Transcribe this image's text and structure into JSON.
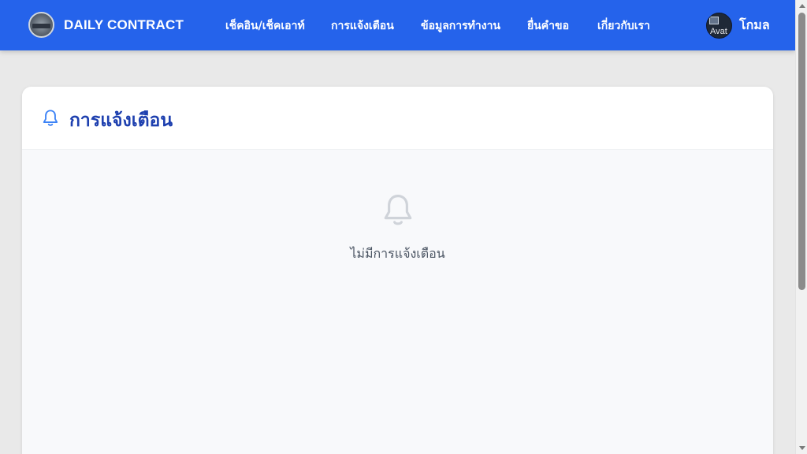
{
  "brand": {
    "name": "DAILY CONTRACT",
    "logo_icon": "contract-logo-icon"
  },
  "nav": {
    "links": [
      {
        "label": "เช็คอิน/เช็คเอาท์"
      },
      {
        "label": "การแจ้งเตือน"
      },
      {
        "label": "ข้อมูลการทำงาน"
      },
      {
        "label": "ยื่นคำขอ"
      },
      {
        "label": "เกี่ยวกับเรา"
      }
    ]
  },
  "user": {
    "name": "โกมล",
    "avatar_alt": "Avat"
  },
  "notifications": {
    "title": "การแจ้งเตือน",
    "title_icon": "bell-icon",
    "empty_icon": "bell-icon",
    "empty_message": "ไม่มีการแจ้งเตือน"
  },
  "colors": {
    "navbar": "#2563eb",
    "title": "#1e40af",
    "page_background": "#e9e9e9"
  }
}
